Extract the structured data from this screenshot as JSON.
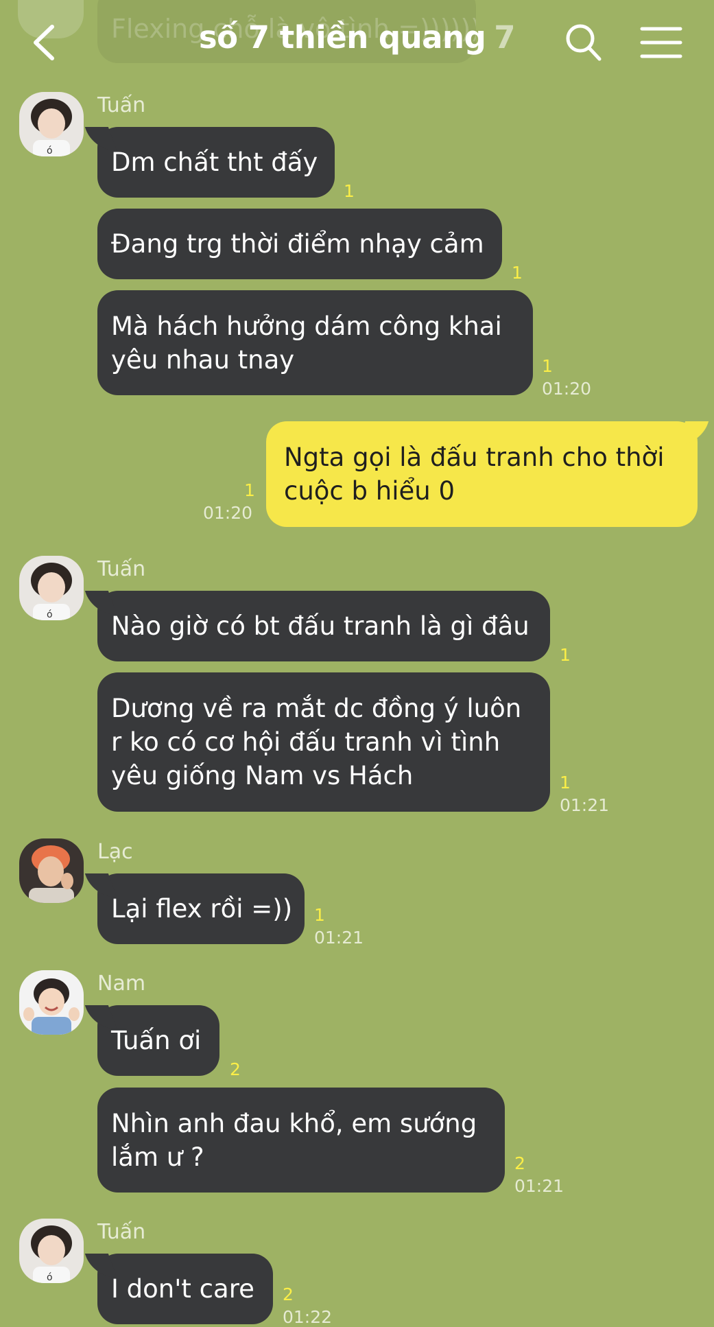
{
  "header": {
    "title": "số 7 thiền quang",
    "member_count": "7"
  },
  "previous_preview": {
    "text": "Flexing chỗ là vô tình =))))))"
  },
  "messages": [
    {
      "sender": "Tuấn",
      "lines": [
        "Dm chất tht đấy"
      ],
      "unread": "1"
    },
    {
      "lines": [
        "Đang trg thời điểm nhạy cảm"
      ],
      "unread": "1"
    },
    {
      "lines": [
        "Mà hách hưởng dám công khai",
        "yêu nhau tnay"
      ],
      "unread": "1",
      "time": "01:20"
    },
    {
      "mine": true,
      "lines": [
        "Ngta gọi là đấu tranh cho thời",
        "cuộc b hiểu 0"
      ],
      "unread": "1",
      "time": "01:20"
    },
    {
      "sender": "Tuấn",
      "lines": [
        "Nào giờ có bt đấu tranh là gì đâu"
      ],
      "unread": "1"
    },
    {
      "lines": [
        "Dương về ra mắt dc đồng ý luôn",
        "r ko có cơ hội đấu tranh vì tình",
        "yêu giống Nam vs Hách"
      ],
      "unread": "1",
      "time": "01:21"
    },
    {
      "sender": "Lạc",
      "lines": [
        "Lại flex rồi =))"
      ],
      "unread": "1",
      "time": "01:21"
    },
    {
      "sender": "Nam",
      "lines": [
        "Tuấn ơi"
      ],
      "unread": "2"
    },
    {
      "lines": [
        "Nhìn anh đau khổ, em sướng",
        "lắm ư ?"
      ],
      "unread": "2",
      "time": "01:21"
    },
    {
      "sender": "Tuấn",
      "lines": [
        "I don't care"
      ],
      "unread": "2",
      "time": "01:22"
    }
  ],
  "colors": {
    "chat_background": "#9eb264",
    "bubble_other": "#38393b",
    "bubble_mine": "#f6e74a",
    "unread_count": "#fbee47"
  },
  "icons": [
    "back-arrow-icon",
    "search-icon",
    "menu-icon"
  ]
}
